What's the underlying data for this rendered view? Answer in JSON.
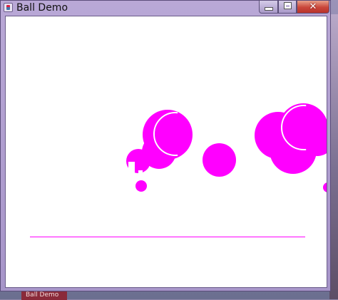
{
  "window": {
    "title": "Ball Demo",
    "controls": {
      "minimize": "—",
      "maximize": "□",
      "close": "✕"
    }
  },
  "icons": {
    "app": "java-cup-icon",
    "minimize": "minimize-icon",
    "maximize": "maximize-icon",
    "close": "close-icon"
  },
  "canvas": {
    "background": "#ffffff",
    "ball_color": "#ff00ff",
    "line_color": "#ff00ff"
  },
  "taskbar": {
    "item_label": "Ball Demo"
  }
}
